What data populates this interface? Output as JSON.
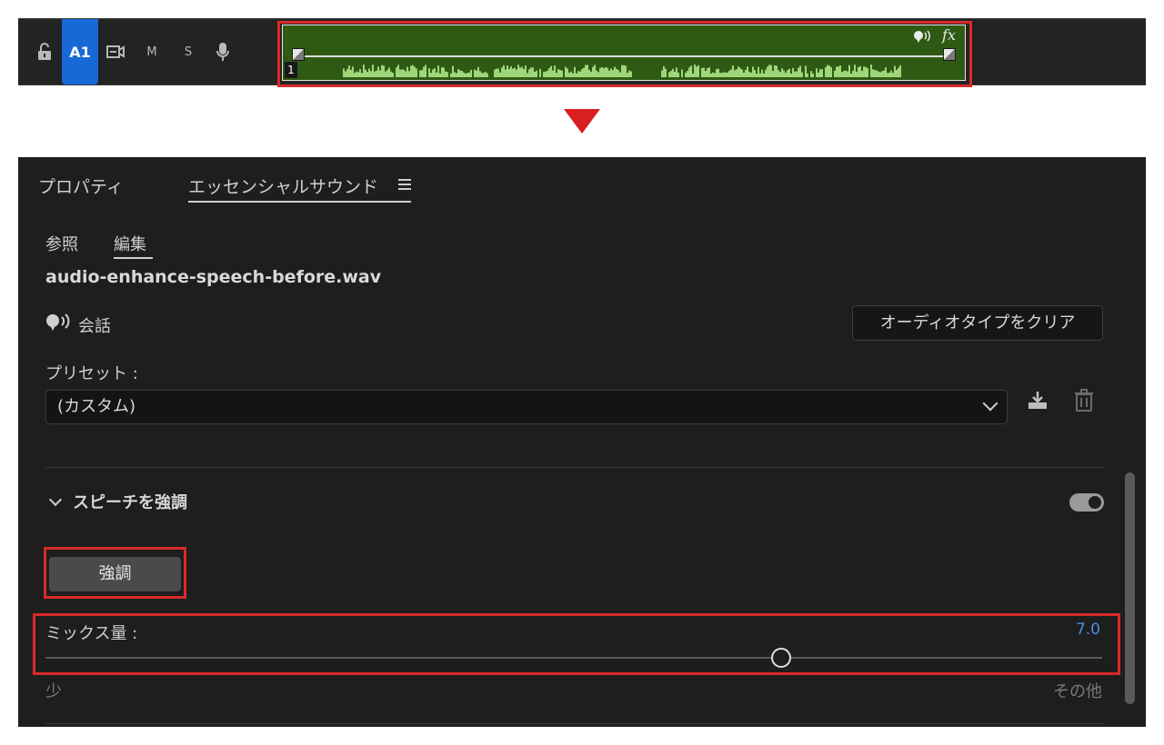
{
  "timeline": {
    "track_label": "A1",
    "mute_label": "M",
    "solo_label": "S",
    "clip_number": "1",
    "fx_label": "fx",
    "clip_color": "#2f5a14",
    "waveform_color": "#9fd67a",
    "icons": [
      "lock-open-icon",
      "clip-icon",
      "microphone-icon",
      "dialogue-icon",
      "keyframe-icon"
    ]
  },
  "panel": {
    "tabs": [
      {
        "label": "プロパティ"
      },
      {
        "label": "エッセンシャルサウンド"
      }
    ],
    "subtabs": [
      {
        "label": "参照"
      },
      {
        "label": "編集"
      }
    ],
    "file_name": "audio-enhance-speech-before.wav",
    "audio_type": "会話",
    "clear_type_button": "オーディオタイプをクリア",
    "preset_label": "プリセット :",
    "preset_value": "(カスタム)",
    "section_title": "スピーチを強調",
    "enhance_button": "強調",
    "mix_label": "ミックス量 :",
    "mix_value": "7.0",
    "mix_min_label": "少",
    "mix_max_label": "その他",
    "accent_color": "#4a90e2",
    "highlight_color": "#d92a2a"
  }
}
